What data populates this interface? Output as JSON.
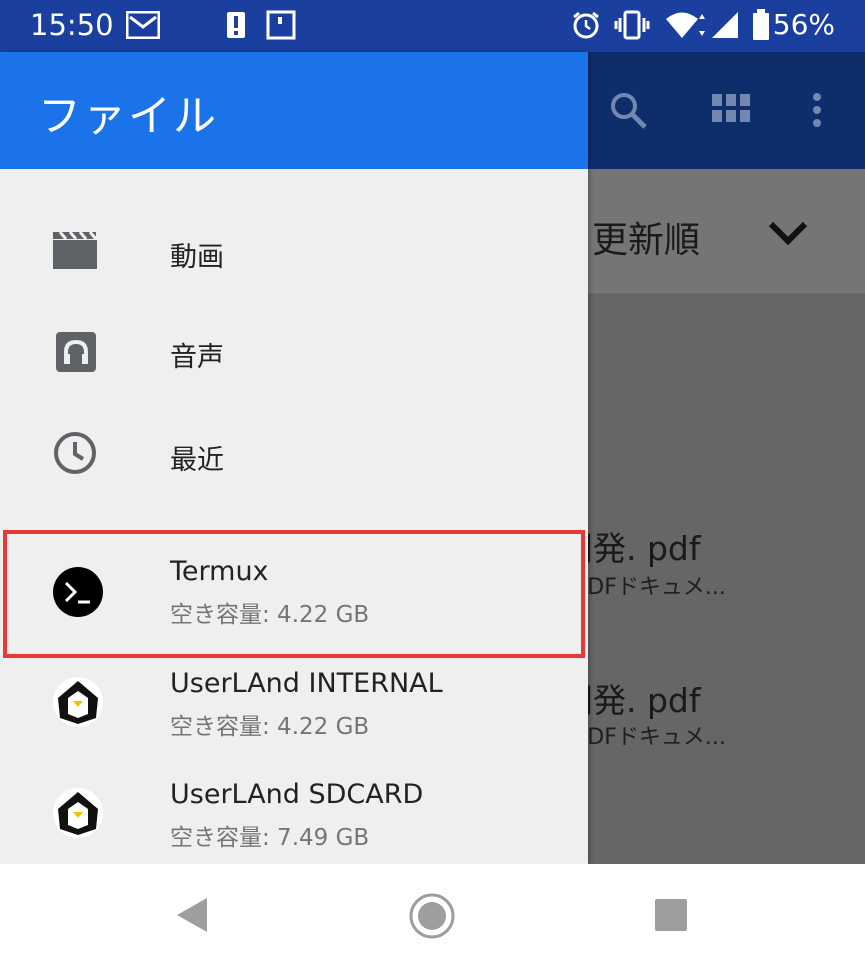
{
  "status_bar": {
    "time": "15:50",
    "battery_percent": "56%",
    "left_icons": [
      "gmail-icon",
      "alert-icon",
      "notification-frame-icon"
    ],
    "right_icons": [
      "alarm-icon",
      "vibrate-icon",
      "wifi-icon",
      "signal-icon",
      "battery-icon"
    ]
  },
  "drawer": {
    "title": "ファイル",
    "nav_items": [
      {
        "label": "動画",
        "icon": "video-icon"
      },
      {
        "label": "音声",
        "icon": "audio-icon"
      },
      {
        "label": "最近",
        "icon": "clock-icon"
      }
    ],
    "roots": [
      {
        "title": "Termux",
        "subtitle": "空き容量: 4.22 GB",
        "icon": "termux-icon",
        "highlighted": true
      },
      {
        "title": "UserLAnd INTERNAL",
        "subtitle": "空き容量: 4.22 GB",
        "icon": "userland-icon"
      },
      {
        "title": "UserLAnd SDCARD",
        "subtitle": "空き容量: 7.49 GB",
        "icon": "userland-icon"
      }
    ]
  },
  "background": {
    "sort_label": "更新順",
    "files": [
      {
        "name": "開発. pdf",
        "type": "PDFドキュメ..."
      },
      {
        "name": "開発. pdf",
        "type": "PDFドキュメ..."
      }
    ],
    "toolbar_icons": [
      "search-icon",
      "grid-view-icon",
      "more-vert-icon"
    ]
  },
  "navigation_bar": {
    "buttons": [
      "back-icon",
      "home-icon",
      "recents-icon"
    ]
  },
  "colors": {
    "status_bar": "#1a3f9e",
    "drawer_header": "#1a73e8",
    "highlight_border": "#e53935"
  }
}
